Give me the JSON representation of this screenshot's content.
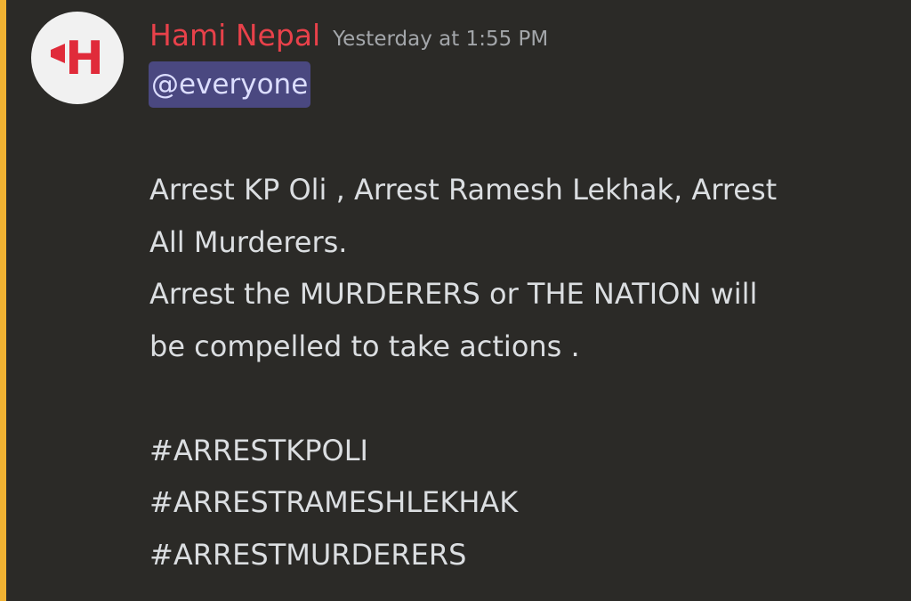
{
  "message": {
    "author": {
      "name": "Hami Nepal",
      "avatar_letter": "H",
      "avatar_icon": "hami-nepal-logo",
      "name_color": "#e8414a"
    },
    "timestamp": "Yesterday at 1:55 PM",
    "mention": "@everyone",
    "mention_highlight_color": "#f0b232",
    "paragraphs": [
      "Arrest KP Oli , Arrest Ramesh Lekhak, Arrest",
      "All Murderers.",
      "Arrest the MURDERERS or THE NATION will",
      "be compelled to take actions ."
    ],
    "hashtags": [
      "#ARRESTKPOLI",
      "#ARRESTRAMESHLEKHAK",
      "#ARRESTMURDERERS"
    ]
  }
}
